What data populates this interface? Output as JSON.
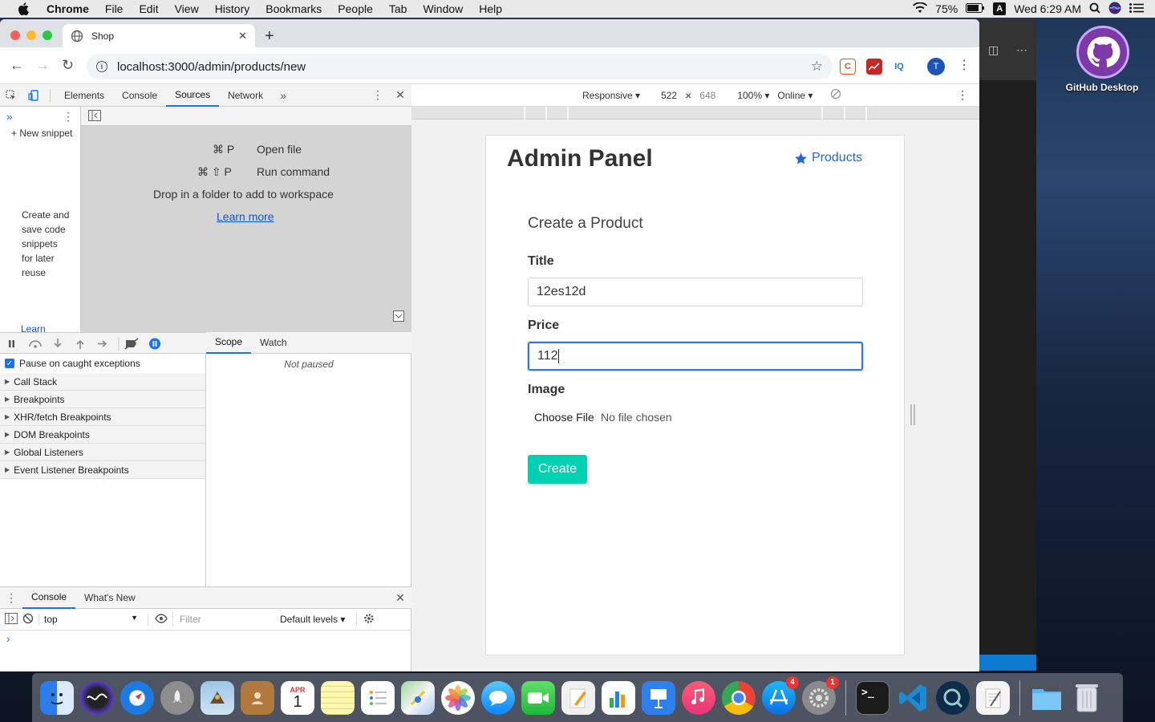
{
  "menubar": {
    "app_name": "Chrome",
    "items": [
      "File",
      "Edit",
      "View",
      "History",
      "Bookmarks",
      "People",
      "Tab",
      "Window",
      "Help"
    ],
    "battery": "75%",
    "input_badge": "A",
    "clock": "Wed 6:29 AM"
  },
  "desktop": {
    "github_label": "GitHub Desktop"
  },
  "browser": {
    "tab_title": "Shop",
    "url": "localhost:3000/admin/products/new",
    "profile_initial": "T",
    "ext_c": "C",
    "ext_iq": "IQ"
  },
  "devtools": {
    "tabs": [
      "Elements",
      "Console",
      "Sources",
      "Network"
    ],
    "active_tab": "Sources",
    "new_snippet": "+ New snippet",
    "snippet_description": "Create and save code snippets for later reuse",
    "snippet_learn": "Learn",
    "shortcut1_key": "⌘ P",
    "shortcut1_label": "Open file",
    "shortcut2_key": "⌘ ⇧ P",
    "shortcut2_label": "Run command",
    "drop_hint": "Drop in a folder to add to workspace",
    "learn_more": "Learn more",
    "pause_on_caught": "Pause on caught exceptions",
    "panes": [
      "Call Stack",
      "Breakpoints",
      "XHR/fetch Breakpoints",
      "DOM Breakpoints",
      "Global Listeners",
      "Event Listener Breakpoints"
    ],
    "scope_tab": "Scope",
    "watch_tab": "Watch",
    "not_paused": "Not paused",
    "drawer_console": "Console",
    "drawer_whatsnew": "What's New",
    "context": "top",
    "filter_placeholder": "Filter",
    "levels": "Default levels ▾",
    "prompt": "›"
  },
  "device_toolbar": {
    "device": "Responsive ▾",
    "width": "522",
    "times": "×",
    "height": "648",
    "zoom": "100% ▾",
    "network": "Online ▾"
  },
  "page": {
    "brand": "Admin Panel",
    "nav_products": "Products",
    "form_title": "Create a Product",
    "title_label": "Title",
    "title_value": "12es12d",
    "price_label": "Price",
    "price_value": "112",
    "image_label": "Image",
    "choose_file": "Choose File",
    "no_file": "No file chosen",
    "create_button": "Create"
  },
  "dock": {
    "calendar_month": "APR",
    "calendar_day": "1",
    "appstore_badge": "4",
    "prefs_badge": "1",
    "terminal_text": ">_"
  }
}
